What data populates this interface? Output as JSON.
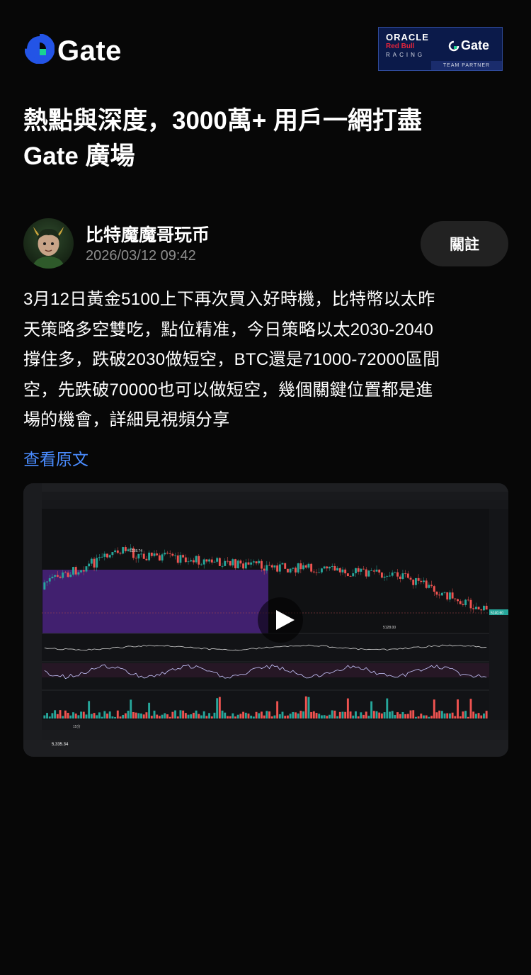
{
  "brand": {
    "logo_text": "Gate",
    "logo_icon": "gate-logo-icon"
  },
  "partner_badge": {
    "oracle": "ORACLE",
    "redbull": "Red Bull",
    "racing": "RACING",
    "gate": "Gate",
    "team_partner": "TEAM PARTNER",
    "colors": {
      "background": "#0b1a4a",
      "redbull": "#e2243b"
    }
  },
  "headline": {
    "line1": "熱點與深度，3000萬+ 用戶一網打盡",
    "line2": "Gate 廣場"
  },
  "author": {
    "name": "比特魔魔哥玩币",
    "timestamp": "2026/03/12 09:42",
    "avatar_icon": "avatar-image",
    "follow_label": "關註"
  },
  "post": {
    "lines": [
      "3月12日黃金5100上下再次買入好時機，比特幣以太昨",
      "天策略多空雙吃，點位精准，今日策略以太2030-2040",
      "撐住多，跌破2030做短空，BTC還是71000-72000區間",
      "空，先跌破70000也可以做短空，幾個關鍵位置都是進",
      "場的機會，詳細見視頻分享"
    ],
    "view_original": "查看原文",
    "link_color": "#4a8cff"
  },
  "video": {
    "play_icon": "play-icon",
    "price_high_label": "5238.74",
    "price_low_label": "5128.00",
    "price_tag": "5140.60",
    "status_price": "5,335.34",
    "timeframe": "15分",
    "colors": {
      "up": "#26a69a",
      "down": "#ef5350",
      "zone": "#5a2a9a",
      "ui_bg": "#151618"
    }
  }
}
